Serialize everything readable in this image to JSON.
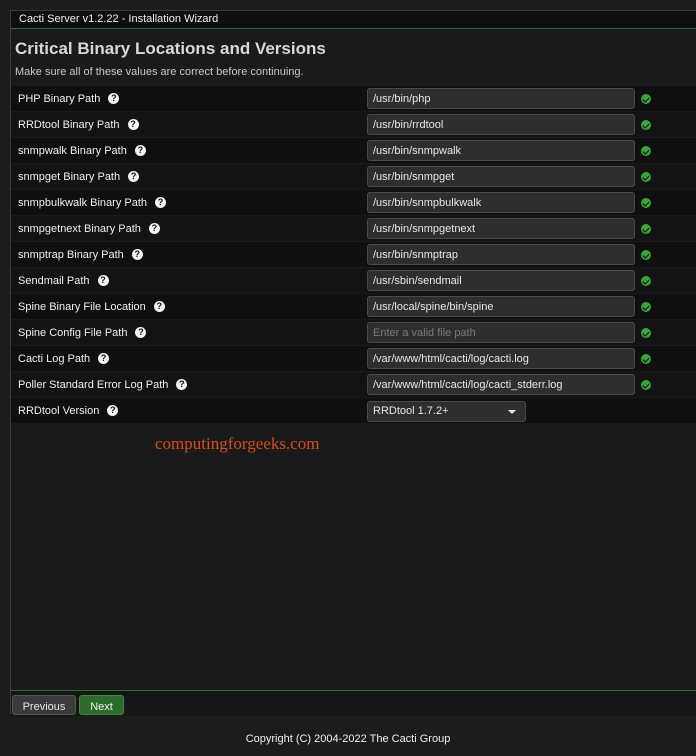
{
  "window": {
    "title": "Cacti Server v1.2.22 - Installation Wizard"
  },
  "page": {
    "heading": "Critical Binary Locations and Versions",
    "subheading": "Make sure all of these values are correct before continuing."
  },
  "rows": [
    {
      "label": "PHP Binary Path",
      "value": "/usr/bin/php",
      "placeholder": "",
      "valid": true
    },
    {
      "label": "RRDtool Binary Path",
      "value": "/usr/bin/rrdtool",
      "placeholder": "",
      "valid": true
    },
    {
      "label": "snmpwalk Binary Path",
      "value": "/usr/bin/snmpwalk",
      "placeholder": "",
      "valid": true
    },
    {
      "label": "snmpget Binary Path",
      "value": "/usr/bin/snmpget",
      "placeholder": "",
      "valid": true
    },
    {
      "label": "snmpbulkwalk Binary Path",
      "value": "/usr/bin/snmpbulkwalk",
      "placeholder": "",
      "valid": true
    },
    {
      "label": "snmpgetnext Binary Path",
      "value": "/usr/bin/snmpgetnext",
      "placeholder": "",
      "valid": true
    },
    {
      "label": "snmptrap Binary Path",
      "value": "/usr/bin/snmptrap",
      "placeholder": "",
      "valid": true
    },
    {
      "label": "Sendmail Path",
      "value": "/usr/sbin/sendmail",
      "placeholder": "",
      "valid": true
    },
    {
      "label": "Spine Binary File Location",
      "value": "/usr/local/spine/bin/spine",
      "placeholder": "",
      "valid": true
    },
    {
      "label": "Spine Config File Path",
      "value": "",
      "placeholder": "Enter a valid file path",
      "valid": true
    },
    {
      "label": "Cacti Log Path",
      "value": "/var/www/html/cacti/log/cacti.log",
      "placeholder": "",
      "valid": true
    },
    {
      "label": "Poller Standard Error Log Path",
      "value": "/var/www/html/cacti/log/cacti_stderr.log",
      "placeholder": "",
      "valid": true
    }
  ],
  "rrdtool_version": {
    "label": "RRDtool Version",
    "selected": "RRDtool 1.7.2+"
  },
  "help_glyph": "?",
  "icons": {
    "help": "question-circle-icon",
    "valid": "check-circle-icon",
    "dropdown": "chevron-down-icon"
  },
  "colors": {
    "accent_green": "#2d6a2d",
    "valid_green": "#3aa53a"
  },
  "watermark": "computingforgeeks.com",
  "buttons": {
    "previous": "Previous",
    "next": "Next"
  },
  "footer": {
    "copyright": "Copyright (C) 2004-2022 The Cacti Group"
  }
}
